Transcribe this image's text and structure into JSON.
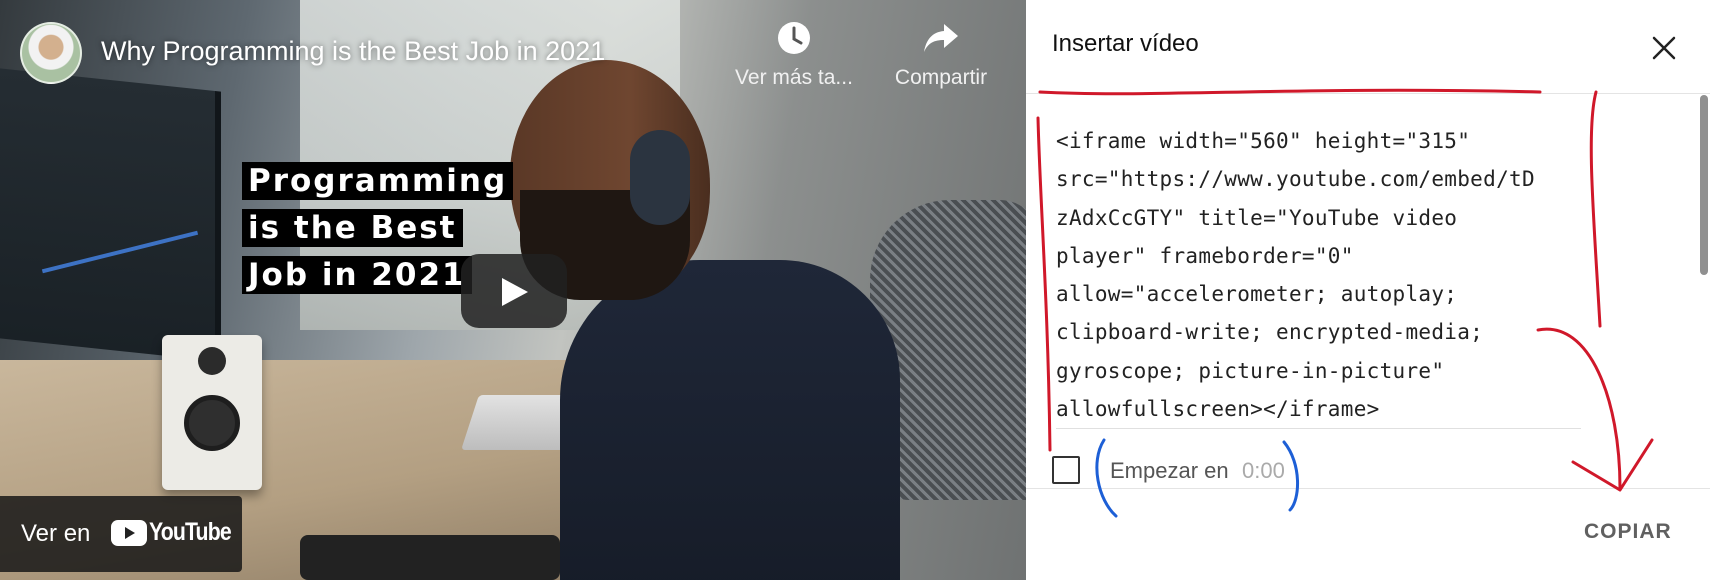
{
  "player": {
    "video_title": "Why Programming is the Best Job in 2021",
    "thumbnail_text": [
      "Programming",
      "is the Best",
      "Job in 2021"
    ],
    "watch_later_label": "Ver más ta...",
    "share_label": "Compartir",
    "watch_on_label": "Ver en",
    "youtube_logo_text": "YouTube"
  },
  "embed_dialog": {
    "title": "Insertar vídeo",
    "code_lines": [
      "<iframe width=\"560\" height=\"315\"",
      "src=\"https://www.youtube.com/embed/tD",
      "zAdxCcGTY\" title=\"YouTube video",
      "player\" frameborder=\"0\"",
      "allow=\"accelerometer; autoplay;",
      "clipboard-write; encrypted-media;",
      "gyroscope; picture-in-picture\"",
      "allowfullscreen></iframe>"
    ],
    "start_at_label": "Empezar en",
    "start_at_time": "0:00",
    "start_at_checked": false,
    "copy_label": "COPIAR"
  },
  "colors": {
    "annotation_red": "#d0182a",
    "annotation_blue": "#1d5fd6",
    "panel_background": "#ffffff"
  }
}
